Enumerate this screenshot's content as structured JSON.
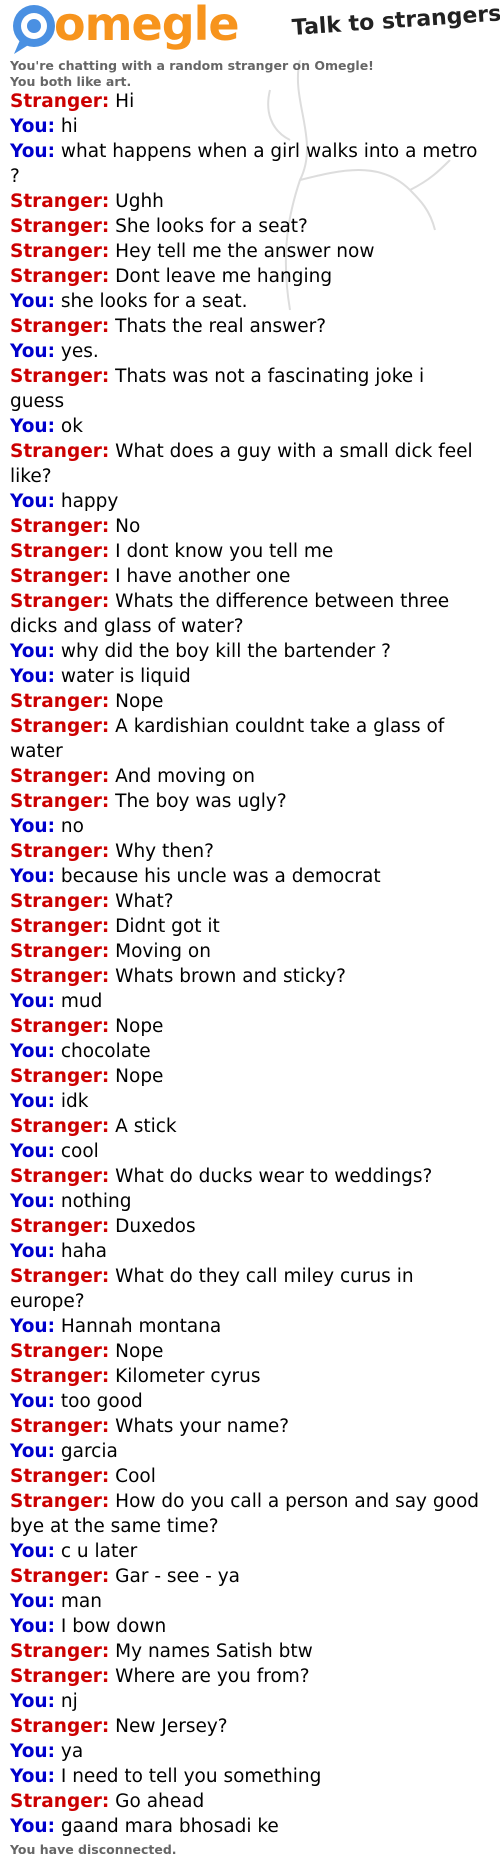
{
  "app": {
    "logo_text": "omegle",
    "tagline": "Talk to strangers!"
  },
  "status": {
    "intro": "You're chatting with a random stranger on Omegle!",
    "interests": "You both like art.",
    "end": "You have disconnected."
  },
  "colors": {
    "stranger": "#cc0000",
    "you": "#0000cc",
    "logo": "#f7941d",
    "logo_icon": "#4a90e2"
  },
  "icons": {
    "logo": "chat-bubble-icon"
  },
  "labels": {
    "stranger": "Stranger:",
    "you": "You:"
  },
  "messages": [
    {
      "speaker": "stranger",
      "text": "Hi"
    },
    {
      "speaker": "you",
      "text": "hi"
    },
    {
      "speaker": "you",
      "text": "what happens when a girl walks into a metro ?"
    },
    {
      "speaker": "stranger",
      "text": "Ughh"
    },
    {
      "speaker": "stranger",
      "text": "She looks for a seat?"
    },
    {
      "speaker": "stranger",
      "text": "Hey tell me the answer now"
    },
    {
      "speaker": "stranger",
      "text": "Dont leave me hanging"
    },
    {
      "speaker": "you",
      "text": "she looks for a seat."
    },
    {
      "speaker": "stranger",
      "text": "Thats the real answer?"
    },
    {
      "speaker": "you",
      "text": "yes."
    },
    {
      "speaker": "stranger",
      "text": "Thats was not a fascinating joke i guess"
    },
    {
      "speaker": "you",
      "text": "ok"
    },
    {
      "speaker": "stranger",
      "text": "What does a guy with a small dick feel like?"
    },
    {
      "speaker": "you",
      "text": "happy"
    },
    {
      "speaker": "stranger",
      "text": "No"
    },
    {
      "speaker": "stranger",
      "text": "I dont know you tell me"
    },
    {
      "speaker": "stranger",
      "text": "I have another one"
    },
    {
      "speaker": "stranger",
      "text": "Whats the difference between three dicks and glass of water?"
    },
    {
      "speaker": "you",
      "text": "why did the boy kill the bartender ?"
    },
    {
      "speaker": "you",
      "text": "water is liquid"
    },
    {
      "speaker": "stranger",
      "text": "Nope"
    },
    {
      "speaker": "stranger",
      "text": "A kardishian couldnt take a glass of water"
    },
    {
      "speaker": "stranger",
      "text": "And moving on"
    },
    {
      "speaker": "stranger",
      "text": "The boy was ugly?"
    },
    {
      "speaker": "you",
      "text": "no"
    },
    {
      "speaker": "stranger",
      "text": "Why then?"
    },
    {
      "speaker": "you",
      "text": "because his uncle was a democrat"
    },
    {
      "speaker": "stranger",
      "text": "What?"
    },
    {
      "speaker": "stranger",
      "text": "Didnt got it"
    },
    {
      "speaker": "stranger",
      "text": "Moving on"
    },
    {
      "speaker": "stranger",
      "text": "Whats brown and sticky?"
    },
    {
      "speaker": "you",
      "text": "mud"
    },
    {
      "speaker": "stranger",
      "text": "Nope"
    },
    {
      "speaker": "you",
      "text": "chocolate"
    },
    {
      "speaker": "stranger",
      "text": "Nope"
    },
    {
      "speaker": "you",
      "text": "idk"
    },
    {
      "speaker": "stranger",
      "text": "A stick"
    },
    {
      "speaker": "you",
      "text": "cool"
    },
    {
      "speaker": "stranger",
      "text": "What do ducks wear to weddings?"
    },
    {
      "speaker": "you",
      "text": "nothing"
    },
    {
      "speaker": "stranger",
      "text": "Duxedos"
    },
    {
      "speaker": "you",
      "text": "haha"
    },
    {
      "speaker": "stranger",
      "text": "What do they call miley curus in europe?"
    },
    {
      "speaker": "you",
      "text": "Hannah montana"
    },
    {
      "speaker": "stranger",
      "text": "Nope"
    },
    {
      "speaker": "stranger",
      "text": "Kilometer cyrus"
    },
    {
      "speaker": "you",
      "text": "too good"
    },
    {
      "speaker": "stranger",
      "text": "Whats your name?"
    },
    {
      "speaker": "you",
      "text": "garcia"
    },
    {
      "speaker": "stranger",
      "text": "Cool"
    },
    {
      "speaker": "stranger",
      "text": "How do you call a person and say good bye at the same time?"
    },
    {
      "speaker": "you",
      "text": "c u later"
    },
    {
      "speaker": "stranger",
      "text": "Gar - see - ya"
    },
    {
      "speaker": "you",
      "text": "man"
    },
    {
      "speaker": "you",
      "text": "I bow down"
    },
    {
      "speaker": "stranger",
      "text": "My names Satish btw"
    },
    {
      "speaker": "stranger",
      "text": "Where are you from?"
    },
    {
      "speaker": "you",
      "text": "nj"
    },
    {
      "speaker": "stranger",
      "text": "New Jersey?"
    },
    {
      "speaker": "you",
      "text": "ya"
    },
    {
      "speaker": "you",
      "text": "I need to tell you something"
    },
    {
      "speaker": "stranger",
      "text": "Go ahead"
    },
    {
      "speaker": "you",
      "text": "gaand mara bhosadi ke"
    }
  ]
}
